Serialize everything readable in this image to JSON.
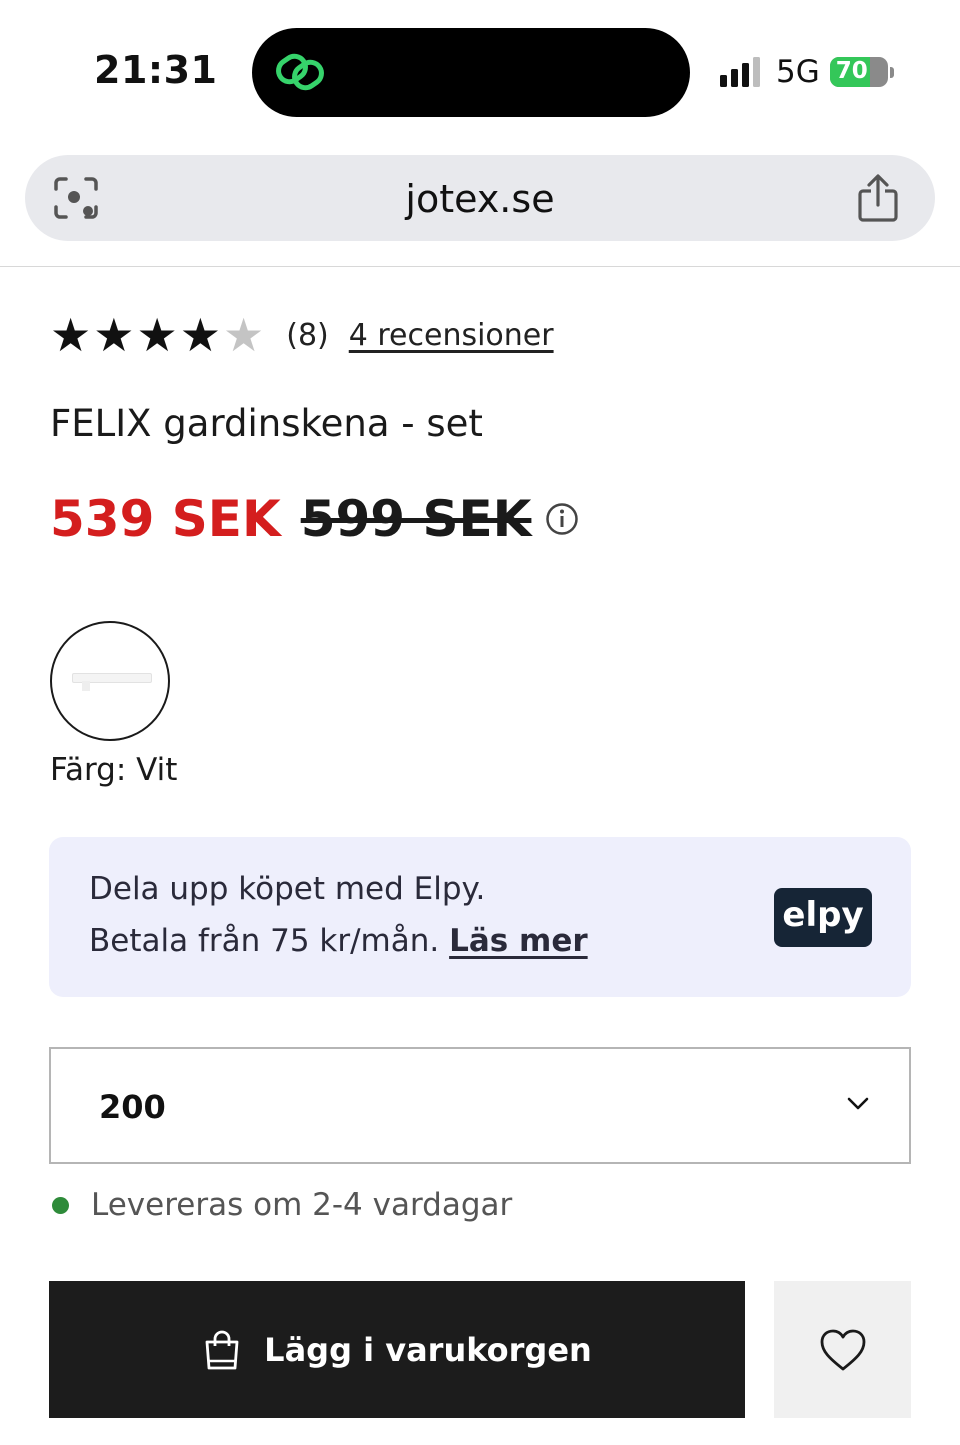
{
  "status_bar": {
    "time": "21:31",
    "network": "5G",
    "battery_level": "70",
    "battery_fraction": 0.7
  },
  "browser": {
    "url": "jotex.se"
  },
  "product": {
    "rating": 4,
    "rating_max": 5,
    "rating_count": "(8)",
    "reviews_link": "4 recensioner",
    "title": "FELIX gardinskena - set",
    "sale_price": "539 SEK",
    "original_price": "599 SEK",
    "color_label": "Färg: Vit"
  },
  "elpy": {
    "line1": "Dela upp köpet med Elpy.",
    "line2": "Betala från 75 kr/mån.",
    "link": "Läs mer",
    "logo": "elpy"
  },
  "size_select": {
    "value": "200"
  },
  "delivery": {
    "text": "Levereras om 2-4 vardagar",
    "status_color": "#2e8b3a"
  },
  "actions": {
    "add_to_cart": "Lägg i varukorgen"
  },
  "colors": {
    "sale_red": "#d41e1e",
    "button_dark": "#1c1c1c",
    "elpy_bg": "#eeeffc"
  }
}
